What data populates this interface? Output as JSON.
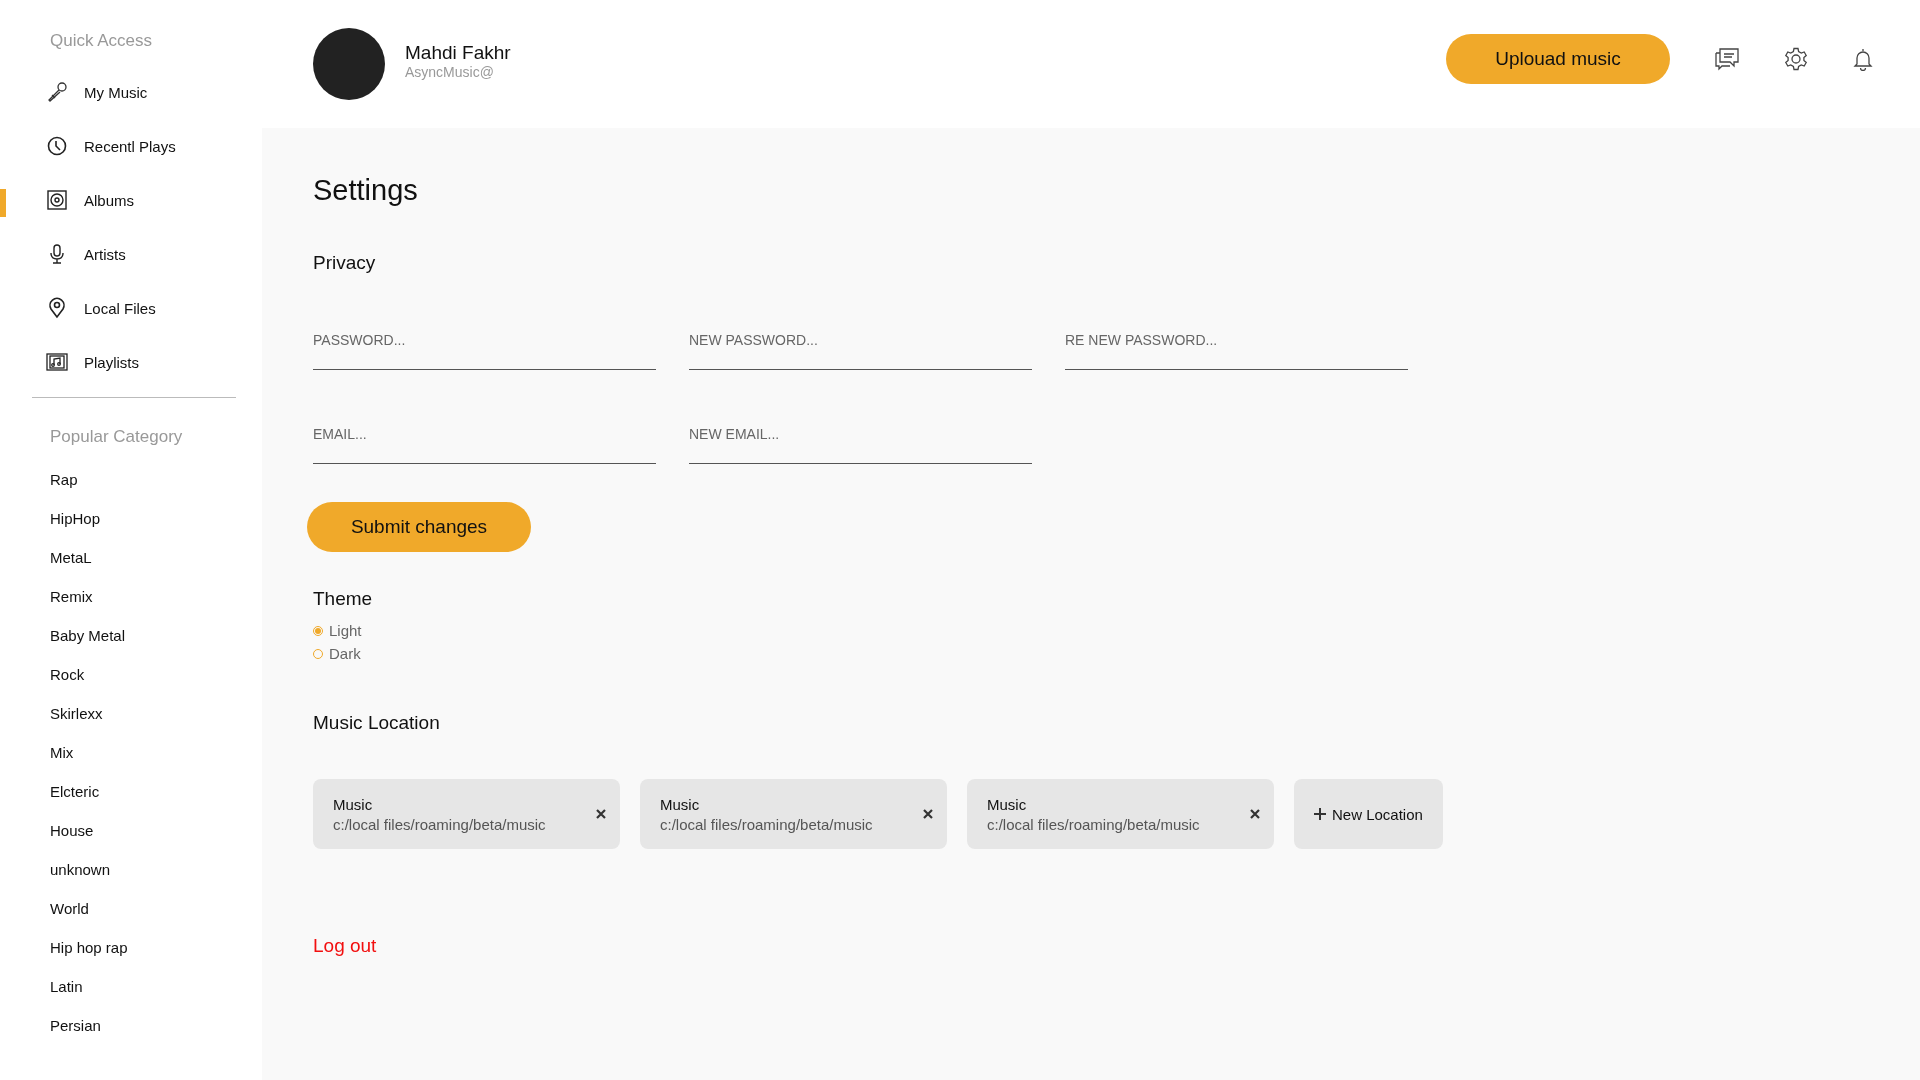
{
  "sidebar": {
    "quick_access_title": "Quick Access",
    "items": [
      {
        "label": "My Music",
        "kind": "mic",
        "selected": false
      },
      {
        "label": "Recentl Plays",
        "kind": "clock",
        "selected": false
      },
      {
        "label": "Albums",
        "kind": "disc",
        "selected": true
      },
      {
        "label": "Artists",
        "kind": "podcast",
        "selected": false
      },
      {
        "label": "Local Files",
        "kind": "pin",
        "selected": false
      },
      {
        "label": "Playlists",
        "kind": "playlist",
        "selected": false
      }
    ],
    "category_title": "Popular Category",
    "categories": [
      "Rap",
      "HipHop",
      "MetaL",
      "Remix",
      "Baby Metal",
      "Rock",
      "Skirlexx",
      "Mix",
      "Elcteric",
      "House",
      "unknown",
      "World",
      "Hip hop rap",
      "Latin",
      "Persian"
    ]
  },
  "header": {
    "user_name": "Mahdi Fakhr",
    "user_handle": "AsyncMusic@",
    "upload_button": "Uplouad music"
  },
  "settings": {
    "title": "Settings",
    "privacy_title": "Privacy",
    "field_rows": [
      [
        {
          "placeholder": "PASSWORD..."
        },
        {
          "placeholder": "NEW PASSWORD..."
        },
        {
          "placeholder": "RE NEW PASSWORD..."
        }
      ],
      [
        {
          "placeholder": "EMAIL..."
        },
        {
          "placeholder": "NEW EMAIL..."
        }
      ]
    ],
    "submit_button": "Submit changes",
    "theme_title": "Theme",
    "theme_options": [
      {
        "label": "Light",
        "selected": true
      },
      {
        "label": "Dark",
        "selected": false
      }
    ],
    "location_title": "Music Location",
    "locations": [
      {
        "name": "Music",
        "path": "c:/local files/roaming/beta/music"
      },
      {
        "name": "Music",
        "path": "c:/local files/roaming/beta/music"
      },
      {
        "name": "Music",
        "path": "c:/local files/roaming/beta/music"
      }
    ],
    "new_location_button": "New Location",
    "logout_link": "Log out"
  }
}
